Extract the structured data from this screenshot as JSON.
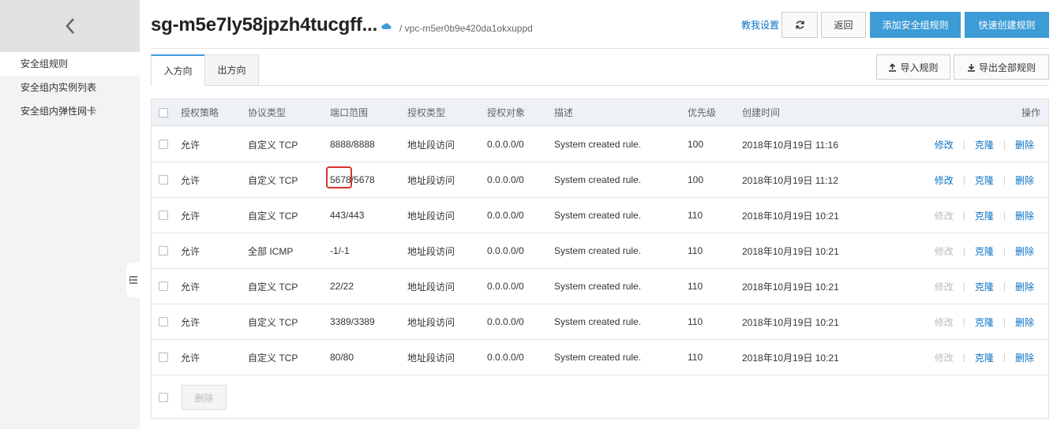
{
  "sidebar": {
    "items": [
      {
        "label": "安全组规则"
      },
      {
        "label": "安全组内实例列表"
      },
      {
        "label": "安全组内弹性网卡"
      }
    ]
  },
  "header": {
    "title": "sg-m5e7ly58jpzh4tucgff...",
    "subtitle": "/ vpc-m5er0b9e420da1okxuppd",
    "help_label": "教我设置",
    "back_label": "返回",
    "add_label": "添加安全组规则",
    "quick_label": "快速创建规则"
  },
  "tabs": {
    "inbound": "入方向",
    "outbound": "出方向",
    "import_label": "导入规则",
    "export_label": "导出全部规则"
  },
  "table": {
    "headers": {
      "policy": "授权策略",
      "protocol": "协议类型",
      "port": "端口范围",
      "auth_type": "授权类型",
      "target": "授权对象",
      "desc": "描述",
      "priority": "优先级",
      "created": "创建时间",
      "ops": "操作"
    },
    "rows": [
      {
        "policy": "允许",
        "protocol": "自定义 TCP",
        "port": "8888/8888",
        "auth_type": "地址段访问",
        "target": "0.0.0.0/0",
        "desc": "System created rule.",
        "priority": "100",
        "created": "2018年10月19日 11:16"
      },
      {
        "policy": "允许",
        "protocol": "自定义 TCP",
        "port": "5678/5678",
        "auth_type": "地址段访问",
        "target": "0.0.0.0/0",
        "desc": "System created rule.",
        "priority": "100",
        "created": "2018年10月19日 11:12"
      },
      {
        "policy": "允许",
        "protocol": "自定义 TCP",
        "port": "443/443",
        "auth_type": "地址段访问",
        "target": "0.0.0.0/0",
        "desc": "System created rule.",
        "priority": "110",
        "created": "2018年10月19日 10:21"
      },
      {
        "policy": "允许",
        "protocol": "全部 ICMP",
        "port": "-1/-1",
        "auth_type": "地址段访问",
        "target": "0.0.0.0/0",
        "desc": "System created rule.",
        "priority": "110",
        "created": "2018年10月19日 10:21"
      },
      {
        "policy": "允许",
        "protocol": "自定义 TCP",
        "port": "22/22",
        "auth_type": "地址段访问",
        "target": "0.0.0.0/0",
        "desc": "System created rule.",
        "priority": "110",
        "created": "2018年10月19日 10:21"
      },
      {
        "policy": "允许",
        "protocol": "自定义 TCP",
        "port": "3389/3389",
        "auth_type": "地址段访问",
        "target": "0.0.0.0/0",
        "desc": "System created rule.",
        "priority": "110",
        "created": "2018年10月19日 10:21"
      },
      {
        "policy": "允许",
        "protocol": "自定义 TCP",
        "port": "80/80",
        "auth_type": "地址段访问",
        "target": "0.0.0.0/0",
        "desc": "System created rule.",
        "priority": "110",
        "created": "2018年10月19日 10:21"
      }
    ],
    "ops": {
      "modify": "修改",
      "clone": "克隆",
      "delete": "删除"
    },
    "footer_delete": "删除"
  },
  "colors": {
    "accent": "#3d9bd6",
    "link": "#0b72c4",
    "highlight": "#d9342b"
  }
}
